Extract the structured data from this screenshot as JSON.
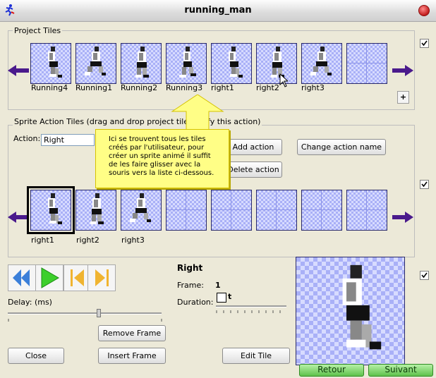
{
  "window": {
    "title": "running_man"
  },
  "project_tiles": {
    "group_title": "Project Tiles",
    "tiles": [
      {
        "label": "Running4"
      },
      {
        "label": "Running1"
      },
      {
        "label": "Running2"
      },
      {
        "label": "Running3"
      },
      {
        "label": "right1"
      },
      {
        "label": "right2"
      },
      {
        "label": "right3"
      },
      {
        "label": ""
      }
    ],
    "add_button": "+"
  },
  "sprite_action": {
    "group_title": "Sprite Action Tiles (drag and drop project tiles here",
    "group_title_tail": "ify this action)",
    "action_label": "Action:",
    "action_value": "Right",
    "add_action": "Add action",
    "change_action_name": "Change action name",
    "delete_action": "Delete action",
    "tiles": [
      {
        "label": "right1"
      },
      {
        "label": "right2"
      },
      {
        "label": "right3"
      },
      {
        "label": ""
      },
      {
        "label": ""
      },
      {
        "label": ""
      },
      {
        "label": ""
      },
      {
        "label": ""
      }
    ]
  },
  "tooltip": {
    "text": "Ici se trouvent tous les tiles créés par l'utilisateur, pour créer un sprite animé il suffit de les faire glisser avec la souris vers la liste ci-dessous."
  },
  "controls": {
    "delay_label": "Delay: (ms)",
    "remove_frame": "Remove Frame",
    "insert_frame": "Insert Frame",
    "close": "Close",
    "edit_tile": "Edit Tile"
  },
  "frame_info": {
    "action_name": "Right",
    "frame_label": "Frame:",
    "frame_value": "1",
    "duration_label": "Duration:",
    "duration_value": "t"
  },
  "footer": {
    "back": "Retour",
    "next": "Suivant"
  },
  "colors": {
    "tile_bg": "#a9b0f7",
    "arrow": "#4a1a8c",
    "tooltip_bg": "#fffe86",
    "nav_green": "#5fc24c"
  }
}
